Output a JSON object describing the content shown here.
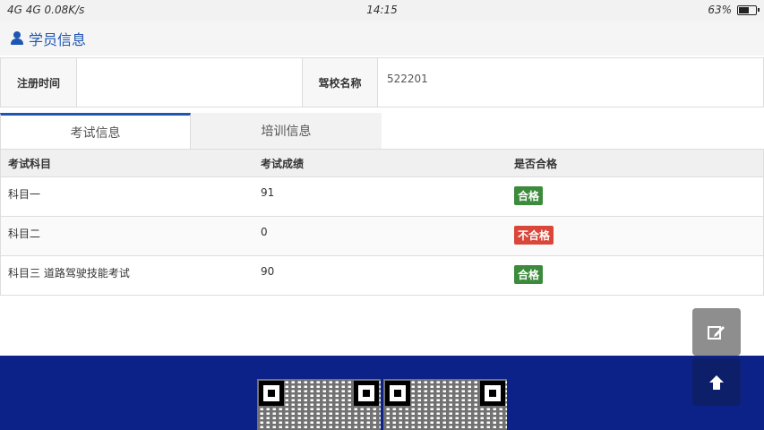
{
  "status_bar": {
    "signal": "4G 4G",
    "speed": "0.08K/s",
    "time": "14:15",
    "battery": "63%",
    "battery_level": 0.63
  },
  "section": {
    "title": "学员信息"
  },
  "info": {
    "reg_time_label": "注册时间",
    "reg_time_value": "",
    "school_label": "驾校名称",
    "school_value": "522201"
  },
  "tabs": [
    {
      "label": "考试信息",
      "active": true
    },
    {
      "label": "培训信息",
      "active": false
    }
  ],
  "exam_table": {
    "headers": [
      "考试科目",
      "考试成绩",
      "是否合格"
    ],
    "rows": [
      {
        "subject": "科目一",
        "score": "91",
        "result": "合格",
        "pass": true
      },
      {
        "subject": "科目二",
        "score": "0",
        "result": "不合格",
        "pass": false
      },
      {
        "subject": "科目三 道路驾驶技能考试",
        "score": "90",
        "result": "合格",
        "pass": true
      }
    ]
  },
  "float_buttons": {
    "edit_icon": "edit-icon",
    "up_icon": "arrow-up-icon"
  },
  "colors": {
    "accent": "#1e56b3",
    "pass": "#3c8a3c",
    "fail": "#d9463a",
    "footer": "#0d2288"
  }
}
